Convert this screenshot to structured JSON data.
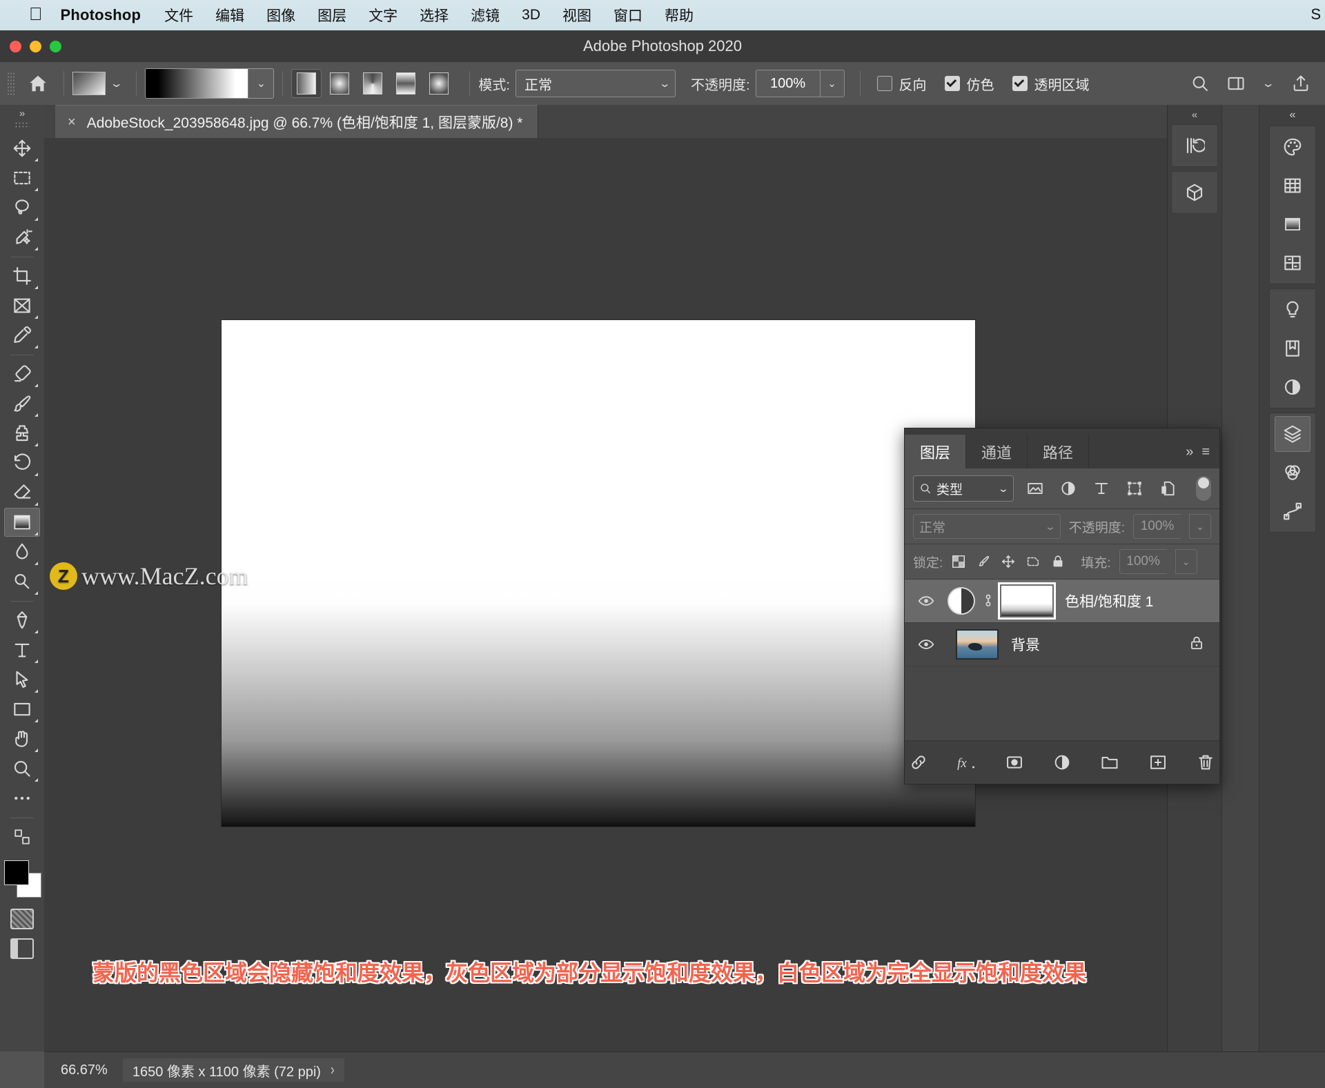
{
  "menubar": {
    "apple_icon": "apple-logo-icon",
    "app_name": "Photoshop",
    "items": [
      "文件",
      "编辑",
      "图像",
      "图层",
      "文字",
      "选择",
      "滤镜",
      "3D",
      "视图",
      "窗口",
      "帮助"
    ]
  },
  "window": {
    "title": "Adobe Photoshop 2020"
  },
  "options_bar": {
    "home_icon": "home-icon",
    "gradient_swatch_label": "渐变预设",
    "gradient_preview_label": "黑色到白色渐变",
    "gradient_types": [
      {
        "name": "linear-gradient-type",
        "active": true
      },
      {
        "name": "radial-gradient-type",
        "active": false
      },
      {
        "name": "angle-gradient-type",
        "active": false
      },
      {
        "name": "reflected-gradient-type",
        "active": false
      },
      {
        "name": "diamond-gradient-type",
        "active": false
      }
    ],
    "mode_label": "模式:",
    "mode_value": "正常",
    "opacity_label": "不透明度:",
    "opacity_value": "100%",
    "checkboxes": [
      {
        "label": "反向",
        "checked": false
      },
      {
        "label": "仿色",
        "checked": true
      },
      {
        "label": "透明区域",
        "checked": true
      }
    ],
    "right_icons": [
      "search-icon",
      "workspace-icon",
      "chevron-down-icon",
      "share-icon"
    ]
  },
  "toolbar": {
    "expand_label": "»",
    "tools": [
      {
        "name": "move-tool",
        "active": false
      },
      {
        "name": "marquee-select-tool",
        "active": false
      },
      {
        "name": "lasso-tool",
        "active": false
      },
      {
        "name": "quick-select-tool",
        "active": false
      },
      {
        "name": "crop-tool",
        "active": false
      },
      {
        "name": "frame-tool",
        "active": false
      },
      {
        "name": "eyedropper-tool",
        "active": false
      },
      {
        "name": "spot-healing-brush-tool",
        "active": false
      },
      {
        "name": "brush-tool",
        "active": false
      },
      {
        "name": "clone-stamp-tool",
        "active": false
      },
      {
        "name": "history-brush-tool",
        "active": false
      },
      {
        "name": "eraser-tool",
        "active": false
      },
      {
        "name": "gradient-tool",
        "active": true
      },
      {
        "name": "blur-tool",
        "active": false
      },
      {
        "name": "dodge-tool",
        "active": false
      },
      {
        "name": "pen-tool",
        "active": false
      },
      {
        "name": "type-tool",
        "active": false
      },
      {
        "name": "path-selection-tool",
        "active": false
      },
      {
        "name": "rectangle-shape-tool",
        "active": false
      },
      {
        "name": "hand-tool",
        "active": false
      },
      {
        "name": "zoom-tool",
        "active": false
      },
      {
        "name": "more-tools",
        "active": false
      }
    ],
    "foreground_color": "#000000",
    "background_color": "#ffffff",
    "quick-mask-label": "快速蒙版",
    "screen-mode-label": "屏幕模式"
  },
  "document": {
    "tab_title": "AdobeStock_203958648.jpg @ 66.7% (色相/饱和度 1, 图层蒙版/8) *",
    "close_glyph": "×"
  },
  "watermark": {
    "badge": "Z",
    "text": "www.MacZ.com"
  },
  "annotation": {
    "text": "蒙版的黑色区域会隐藏饱和度效果，灰色区域为部分显示饱和度效果，白色区域为完全显示饱和度效果",
    "color": "#f4634e"
  },
  "status_bar": {
    "zoom": "66.67%",
    "dimensions": "1650 像素 x 1100 像素 (72 ppi)",
    "expand_glyph": "›"
  },
  "layers_panel": {
    "tabs": [
      {
        "label": "图层",
        "active": true
      },
      {
        "label": "通道",
        "active": false
      },
      {
        "label": "路径",
        "active": false
      }
    ],
    "collapse_glyph": "»",
    "menu_glyph": "≡",
    "filter": {
      "search_icon": "search-icon",
      "type_label": "类型",
      "icons": [
        "pixel-filter-icon",
        "adjustment-filter-icon",
        "type-filter-icon",
        "shape-filter-icon",
        "smart-object-filter-icon"
      ],
      "toggle_label": "筛选开关"
    },
    "blend_mode": "正常",
    "opacity_label": "不透明度:",
    "opacity_value": "100%",
    "lock_label": "锁定:",
    "lock_icons": [
      "lock-transparent-pixels-icon",
      "lock-image-pixels-icon",
      "lock-position-icon",
      "lock-artboard-icon",
      "lock-all-icon"
    ],
    "fill_label": "填充:",
    "fill_value": "100%",
    "layers": [
      {
        "name": "色相/饱和度 1",
        "type": "adjustment",
        "visible": true,
        "selected": true,
        "linked": true,
        "locked": false
      },
      {
        "name": "背景",
        "type": "image",
        "visible": true,
        "selected": false,
        "linked": false,
        "locked": true
      }
    ],
    "footer_icons": [
      "link-layers-icon",
      "layer-style-fx-icon",
      "add-layer-mask-icon",
      "new-adjustment-layer-icon",
      "new-group-icon",
      "new-layer-icon",
      "delete-layer-icon"
    ]
  },
  "right_dock": {
    "column1": [
      "history-icon",
      "3d-panel-icon"
    ],
    "column2": [
      "color-icon",
      "swatches-grid-icon",
      "gradients-icon",
      "patterns-icon",
      "adjustments-bulb-icon",
      "libraries-icon",
      "properties-circle-icon",
      "layers-stack-icon",
      "channels-icon",
      "paths-icon"
    ]
  }
}
